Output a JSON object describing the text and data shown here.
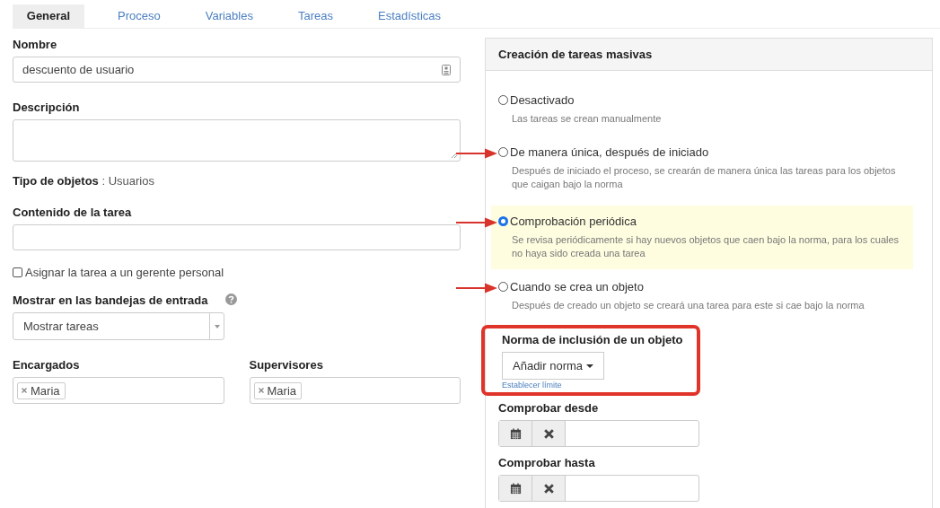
{
  "tabs": [
    {
      "label": "General",
      "selected": true
    },
    {
      "label": "Proceso",
      "selected": false
    },
    {
      "label": "Variables",
      "selected": false
    },
    {
      "label": "Tareas",
      "selected": false
    },
    {
      "label": "Estadísticas",
      "selected": false
    }
  ],
  "general": {
    "name": {
      "label": "Nombre",
      "value": "descuento de usuario"
    },
    "description": {
      "label": "Descripción"
    },
    "object_type": {
      "label": "Tipo de objetos",
      "separator": " : ",
      "value": "Usuarios"
    },
    "task_content": {
      "label": "Contenido de la tarea"
    },
    "assign_manager": {
      "label": "Asignar la tarea a un gerente personal",
      "checked": false
    },
    "inbox": {
      "label": "Mostrar en las bandejas de entrada",
      "value": "Mostrar tareas"
    },
    "assignees": {
      "label": "Encargados",
      "tags": [
        "Maria"
      ]
    },
    "supervisors": {
      "label": "Supervisores",
      "tags": [
        "Maria"
      ]
    }
  },
  "mass_creation": {
    "title": "Creación de tareas masivas",
    "options": [
      {
        "label": "Desactivado",
        "description": "Las tareas se crean manualmente",
        "selected": false
      },
      {
        "label": "De manera única, después de iniciado",
        "description": "Después de iniciado el proceso, se crearán de manera única las tareas para los objetos que caigan bajo la norma",
        "selected": false,
        "annotated": true
      },
      {
        "label": "Comprobación periódica",
        "description": "Se revisa periódicamente si hay nuevos objetos que caen bajo la norma, para los cuales no haya sido creada una tarea",
        "selected": true,
        "annotated": true
      },
      {
        "label": "Cuando se crea un objeto",
        "description": "Después de creado un objeto se creará una tarea para este si cae bajo la norma",
        "selected": false,
        "annotated": true
      }
    ],
    "rule": {
      "label": "Norma de inclusión de un objeto",
      "button": "Añadir norma",
      "link": "Establecer límite",
      "highlighted": true
    },
    "dates": [
      {
        "label": "Comprobar desde"
      },
      {
        "label": "Comprobar hasta"
      }
    ]
  }
}
